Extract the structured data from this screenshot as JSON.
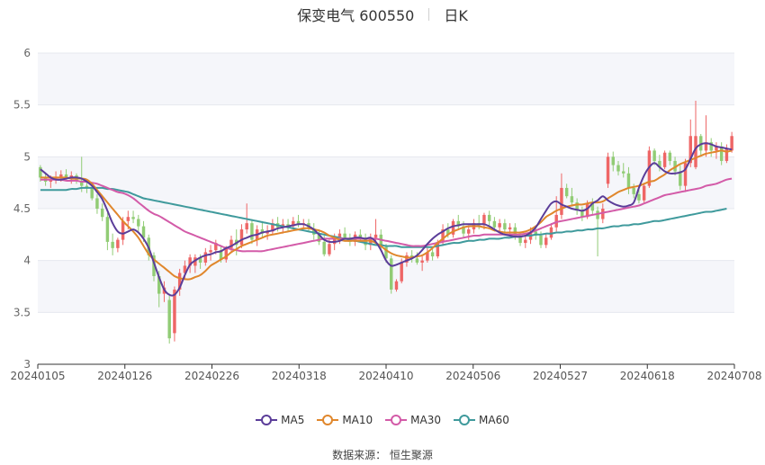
{
  "title": {
    "name": "保变电气 600550",
    "period": "日K"
  },
  "source": {
    "label": "数据来源：",
    "value": "恒生聚源"
  },
  "colors": {
    "up": "#ee6666",
    "down": "#91cc75",
    "MA5": "#5b3d99",
    "MA10": "#e0872c",
    "MA30": "#d35ba8",
    "MA60": "#3f9a9c"
  },
  "chart_data": {
    "type": "candlestick",
    "ylim": [
      3,
      6
    ],
    "y_ticks": [
      "3",
      "3.5",
      "4",
      "4.5",
      "5",
      "5.5",
      "6"
    ],
    "x_ticks": [
      "20240105",
      "20240126",
      "20240226",
      "20240318",
      "20240410",
      "20240506",
      "20240527",
      "20240618",
      "20240708"
    ],
    "legend": [
      "MA5",
      "MA10",
      "MA30",
      "MA60"
    ],
    "legend_position": "bottom",
    "ohlc": [
      [
        4.9,
        4.92,
        4.76,
        4.8
      ],
      [
        4.8,
        4.84,
        4.72,
        4.76
      ],
      [
        4.76,
        4.82,
        4.7,
        4.78
      ],
      [
        4.78,
        4.86,
        4.74,
        4.8
      ],
      [
        4.8,
        4.87,
        4.76,
        4.83
      ],
      [
        4.83,
        4.88,
        4.78,
        4.8
      ],
      [
        4.8,
        4.86,
        4.74,
        4.82
      ],
      [
        4.82,
        4.84,
        4.74,
        4.77
      ],
      [
        4.77,
        5.0,
        4.66,
        4.72
      ],
      [
        4.72,
        4.78,
        4.65,
        4.7
      ],
      [
        4.7,
        4.72,
        4.58,
        4.6
      ],
      [
        4.6,
        4.64,
        4.45,
        4.5
      ],
      [
        4.5,
        4.55,
        4.38,
        4.42
      ],
      [
        4.42,
        4.46,
        4.1,
        4.18
      ],
      [
        4.18,
        4.26,
        4.05,
        4.12
      ],
      [
        4.12,
        4.22,
        4.08,
        4.2
      ],
      [
        4.2,
        4.42,
        4.15,
        4.38
      ],
      [
        4.38,
        4.48,
        4.3,
        4.42
      ],
      [
        4.42,
        4.48,
        4.36,
        4.4
      ],
      [
        4.4,
        4.44,
        4.28,
        4.33
      ],
      [
        4.33,
        4.38,
        4.18,
        4.22
      ],
      [
        4.22,
        4.25,
        4.0,
        4.05
      ],
      [
        4.05,
        4.08,
        3.8,
        3.85
      ],
      [
        3.85,
        3.9,
        3.55,
        3.68
      ],
      [
        3.68,
        3.8,
        3.6,
        3.74
      ],
      [
        3.62,
        3.66,
        3.2,
        3.25
      ],
      [
        3.3,
        3.75,
        3.22,
        3.72
      ],
      [
        3.72,
        3.92,
        3.66,
        3.88
      ],
      [
        3.88,
        4.0,
        3.82,
        3.95
      ],
      [
        3.95,
        4.06,
        3.88,
        4.03
      ],
      [
        3.95,
        4.06,
        3.88,
        4.03
      ],
      [
        4.03,
        4.06,
        3.92,
        3.98
      ],
      [
        3.98,
        4.12,
        3.95,
        4.08
      ],
      [
        4.08,
        4.15,
        4.0,
        4.1
      ],
      [
        4.1,
        4.2,
        4.06,
        4.17
      ],
      [
        4.1,
        4.14,
        3.98,
        4.01
      ],
      [
        4.01,
        4.14,
        3.98,
        4.12
      ],
      [
        4.12,
        4.24,
        4.08,
        4.2
      ],
      [
        4.2,
        4.3,
        4.05,
        4.15
      ],
      [
        4.15,
        4.35,
        4.12,
        4.3
      ],
      [
        4.3,
        4.55,
        4.26,
        4.36
      ],
      [
        4.36,
        4.4,
        4.16,
        4.2
      ],
      [
        4.2,
        4.34,
        4.14,
        4.3
      ],
      [
        4.3,
        4.38,
        4.22,
        4.26
      ],
      [
        4.26,
        4.34,
        4.2,
        4.28
      ],
      [
        4.28,
        4.4,
        4.25,
        4.36
      ],
      [
        4.36,
        4.42,
        4.28,
        4.32
      ],
      [
        4.32,
        4.4,
        4.26,
        4.35
      ],
      [
        4.35,
        4.4,
        4.28,
        4.33
      ],
      [
        4.33,
        4.42,
        4.3,
        4.38
      ],
      [
        4.38,
        4.44,
        4.32,
        4.35
      ],
      [
        4.35,
        4.4,
        4.3,
        4.36
      ],
      [
        4.36,
        4.4,
        4.28,
        4.31
      ],
      [
        4.31,
        4.36,
        4.2,
        4.25
      ],
      [
        4.25,
        4.3,
        4.15,
        4.18
      ],
      [
        4.18,
        4.24,
        4.04,
        4.06
      ],
      [
        4.06,
        4.2,
        4.04,
        4.16
      ],
      [
        4.16,
        4.26,
        4.1,
        4.22
      ],
      [
        4.22,
        4.3,
        4.16,
        4.26
      ],
      [
        4.26,
        4.32,
        4.18,
        4.22
      ],
      [
        4.22,
        4.26,
        4.14,
        4.18
      ],
      [
        4.18,
        4.28,
        4.14,
        4.25
      ],
      [
        4.25,
        4.3,
        4.18,
        4.22
      ],
      [
        4.22,
        4.26,
        4.1,
        4.15
      ],
      [
        4.15,
        4.26,
        4.1,
        4.22
      ],
      [
        4.22,
        4.4,
        4.18,
        4.25
      ],
      [
        4.25,
        4.3,
        4.1,
        4.13
      ],
      [
        4.13,
        4.16,
        3.98,
        4.02
      ],
      [
        4.02,
        4.05,
        3.68,
        3.72
      ],
      [
        3.72,
        3.82,
        3.7,
        3.8
      ],
      [
        3.8,
        4.02,
        3.78,
        3.98
      ],
      [
        3.98,
        4.08,
        3.94,
        4.05
      ],
      [
        4.05,
        4.1,
        3.98,
        4.02
      ],
      [
        4.02,
        4.08,
        3.96,
        3.98
      ],
      [
        3.98,
        4.04,
        3.9,
        4.0
      ],
      [
        4.0,
        4.12,
        3.98,
        4.08
      ],
      [
        4.08,
        4.12,
        4.0,
        4.04
      ],
      [
        4.04,
        4.2,
        4.02,
        4.18
      ],
      [
        4.18,
        4.35,
        4.14,
        4.3
      ],
      [
        4.3,
        4.36,
        4.22,
        4.25
      ],
      [
        4.25,
        4.4,
        4.22,
        4.38
      ],
      [
        4.38,
        4.44,
        4.3,
        4.33
      ],
      [
        4.33,
        4.38,
        4.22,
        4.26
      ],
      [
        4.26,
        4.34,
        4.2,
        4.3
      ],
      [
        4.3,
        4.4,
        4.26,
        4.36
      ],
      [
        4.36,
        4.44,
        4.3,
        4.34
      ],
      [
        4.34,
        4.46,
        4.3,
        4.44
      ],
      [
        4.44,
        4.48,
        4.32,
        4.38
      ],
      [
        4.38,
        4.42,
        4.28,
        4.32
      ],
      [
        4.32,
        4.4,
        4.28,
        4.36
      ],
      [
        4.36,
        4.4,
        4.26,
        4.3
      ],
      [
        4.3,
        4.36,
        4.24,
        4.32
      ],
      [
        4.32,
        4.36,
        4.2,
        4.24
      ],
      [
        4.24,
        4.28,
        4.14,
        4.17
      ],
      [
        4.17,
        4.24,
        4.12,
        4.2
      ],
      [
        4.2,
        4.32,
        4.16,
        4.28
      ],
      [
        4.28,
        4.34,
        4.2,
        4.24
      ],
      [
        4.24,
        4.28,
        4.12,
        4.15
      ],
      [
        4.15,
        4.26,
        4.12,
        4.22
      ],
      [
        4.22,
        4.36,
        4.2,
        4.32
      ],
      [
        4.32,
        4.62,
        4.28,
        4.44
      ],
      [
        4.44,
        4.84,
        4.4,
        4.7
      ],
      [
        4.7,
        4.74,
        4.6,
        4.62
      ],
      [
        4.62,
        4.7,
        4.52,
        4.56
      ],
      [
        4.56,
        4.6,
        4.44,
        4.48
      ],
      [
        4.48,
        4.52,
        4.38,
        4.42
      ],
      [
        4.42,
        4.58,
        4.4,
        4.55
      ],
      [
        4.55,
        4.6,
        4.44,
        4.48
      ],
      [
        4.48,
        4.52,
        4.04,
        4.4
      ],
      [
        4.4,
        4.55,
        4.36,
        4.5
      ],
      [
        4.74,
        5.04,
        4.7,
        5.0
      ],
      [
        5.0,
        5.05,
        4.86,
        4.92
      ],
      [
        4.92,
        4.96,
        4.82,
        4.86
      ],
      [
        4.86,
        4.94,
        4.8,
        4.84
      ],
      [
        4.84,
        4.9,
        4.64,
        4.7
      ],
      [
        4.7,
        4.74,
        4.6,
        4.64
      ],
      [
        4.64,
        4.72,
        4.55,
        4.58
      ],
      [
        4.58,
        4.74,
        4.56,
        4.72
      ],
      [
        4.72,
        5.1,
        4.7,
        5.06
      ],
      [
        5.06,
        5.08,
        4.92,
        4.96
      ],
      [
        4.96,
        5.02,
        4.86,
        4.9
      ],
      [
        4.9,
        5.06,
        4.88,
        5.04
      ],
      [
        5.04,
        5.06,
        4.92,
        4.96
      ],
      [
        4.96,
        5.0,
        4.82,
        4.86
      ],
      [
        4.86,
        4.92,
        4.68,
        4.72
      ],
      [
        4.72,
        4.98,
        4.66,
        4.94
      ],
      [
        4.94,
        5.36,
        4.9,
        5.2
      ],
      [
        4.9,
        5.54,
        4.88,
        5.2
      ],
      [
        5.2,
        5.22,
        5.0,
        5.06
      ],
      [
        5.06,
        5.4,
        5.0,
        5.14
      ],
      [
        5.14,
        5.18,
        5.0,
        5.06
      ],
      [
        5.06,
        5.14,
        4.98,
        5.1
      ],
      [
        5.1,
        5.14,
        4.92,
        4.96
      ],
      [
        4.96,
        5.12,
        4.94,
        5.08
      ],
      [
        5.06,
        5.24,
        5.04,
        5.2
      ]
    ],
    "ma5": [
      4.88,
      4.84,
      4.8,
      4.78,
      4.78,
      4.79,
      4.8,
      4.8,
      4.79,
      4.76,
      4.72,
      4.66,
      4.59,
      4.48,
      4.36,
      4.28,
      4.26,
      4.28,
      4.3,
      4.27,
      4.21,
      4.12,
      3.98,
      3.84,
      3.72,
      3.67,
      3.67,
      3.74,
      3.86,
      3.96,
      4.0,
      4.03,
      4.05,
      4.06,
      4.08,
      4.09,
      4.12,
      4.14,
      4.17,
      4.2,
      4.22,
      4.24,
      4.25,
      4.27,
      4.28,
      4.29,
      4.31,
      4.32,
      4.33,
      4.34,
      4.35,
      4.35,
      4.33,
      4.3,
      4.25,
      4.2,
      4.18,
      4.18,
      4.19,
      4.21,
      4.21,
      4.22,
      4.22,
      4.21,
      4.22,
      4.18,
      4.1,
      4.0,
      3.95,
      3.96,
      3.98,
      4.0,
      4.02,
      4.05,
      4.1,
      4.16,
      4.21,
      4.25,
      4.28,
      4.31,
      4.33,
      4.34,
      4.35,
      4.35,
      4.35,
      4.35,
      4.35,
      4.33,
      4.3,
      4.27,
      4.25,
      4.24,
      4.23,
      4.23,
      4.24,
      4.27,
      4.32,
      4.4,
      4.48,
      4.55,
      4.57,
      4.54,
      4.52,
      4.5,
      4.49,
      4.48,
      4.5,
      4.55,
      4.58,
      4.62,
      4.58,
      4.55,
      4.53,
      4.52,
      4.53,
      4.56,
      4.7,
      4.82,
      4.9,
      4.94,
      4.9,
      4.86,
      4.84,
      4.84,
      4.85,
      4.88,
      4.98,
      5.08,
      5.12,
      5.13,
      5.12,
      5.1,
      5.09,
      5.08,
      5.07
    ],
    "ma10": [
      4.8,
      4.8,
      4.8,
      4.8,
      4.8,
      4.8,
      4.79,
      4.79,
      4.79,
      4.78,
      4.74,
      4.68,
      4.62,
      4.56,
      4.5,
      4.44,
      4.38,
      4.33,
      4.28,
      4.22,
      4.14,
      4.06,
      4.01,
      3.97,
      3.93,
      3.89,
      3.85,
      3.83,
      3.82,
      3.82,
      3.84,
      3.86,
      3.9,
      3.95,
      3.98,
      4.01,
      4.04,
      4.08,
      4.11,
      4.14,
      4.16,
      4.18,
      4.2,
      4.22,
      4.24,
      4.25,
      4.26,
      4.27,
      4.28,
      4.29,
      4.3,
      4.31,
      4.31,
      4.3,
      4.29,
      4.27,
      4.24,
      4.22,
      4.2,
      4.19,
      4.19,
      4.19,
      4.19,
      4.19,
      4.19,
      4.17,
      4.14,
      4.1,
      4.07,
      4.05,
      4.04,
      4.03,
      4.03,
      4.04,
      4.05,
      4.08,
      4.12,
      4.17,
      4.21,
      4.25,
      4.28,
      4.3,
      4.32,
      4.33,
      4.33,
      4.33,
      4.32,
      4.31,
      4.29,
      4.28,
      4.27,
      4.27,
      4.27,
      4.27,
      4.28,
      4.3,
      4.33,
      4.37,
      4.42,
      4.45,
      4.48,
      4.5,
      4.52,
      4.53,
      4.54,
      4.54,
      4.55,
      4.56,
      4.56,
      4.57,
      4.6,
      4.63,
      4.66,
      4.68,
      4.7,
      4.71,
      4.72,
      4.74,
      4.76,
      4.77,
      4.8,
      4.83,
      4.87,
      4.9,
      4.93,
      4.95,
      4.97,
      4.99,
      5.01,
      5.03,
      5.04,
      5.05,
      5.06,
      5.05,
      5.06
    ],
    "ma30": [
      4.78,
      4.78,
      4.78,
      4.78,
      4.78,
      4.77,
      4.77,
      4.77,
      4.76,
      4.76,
      4.75,
      4.74,
      4.72,
      4.7,
      4.68,
      4.66,
      4.65,
      4.63,
      4.6,
      4.56,
      4.52,
      4.48,
      4.45,
      4.43,
      4.4,
      4.37,
      4.34,
      4.31,
      4.28,
      4.26,
      4.24,
      4.22,
      4.2,
      4.18,
      4.16,
      4.14,
      4.12,
      4.11,
      4.1,
      4.09,
      4.09,
      4.09,
      4.09,
      4.09,
      4.1,
      4.11,
      4.12,
      4.13,
      4.14,
      4.15,
      4.16,
      4.17,
      4.18,
      4.19,
      4.2,
      4.21,
      4.21,
      4.21,
      4.21,
      4.21,
      4.21,
      4.21,
      4.21,
      4.21,
      4.21,
      4.21,
      4.2,
      4.19,
      4.18,
      4.17,
      4.16,
      4.15,
      4.14,
      4.14,
      4.14,
      4.15,
      4.16,
      4.17,
      4.18,
      4.19,
      4.2,
      4.21,
      4.22,
      4.23,
      4.24,
      4.24,
      4.25,
      4.25,
      4.25,
      4.25,
      4.25,
      4.25,
      4.25,
      4.25,
      4.26,
      4.27,
      4.29,
      4.31,
      4.33,
      4.35,
      4.37,
      4.38,
      4.39,
      4.4,
      4.41,
      4.42,
      4.43,
      4.44,
      4.45,
      4.46,
      4.47,
      4.48,
      4.49,
      4.5,
      4.51,
      4.52,
      4.53,
      4.55,
      4.57,
      4.59,
      4.61,
      4.63,
      4.64,
      4.65,
      4.66,
      4.67,
      4.68,
      4.69,
      4.7,
      4.72,
      4.73,
      4.74,
      4.76,
      4.78,
      4.79
    ],
    "ma60": [
      4.68,
      4.68,
      4.68,
      4.68,
      4.68,
      4.68,
      4.69,
      4.69,
      4.7,
      4.7,
      4.7,
      4.7,
      4.7,
      4.69,
      4.69,
      4.68,
      4.67,
      4.66,
      4.64,
      4.62,
      4.6,
      4.59,
      4.58,
      4.57,
      4.56,
      4.55,
      4.54,
      4.53,
      4.52,
      4.51,
      4.5,
      4.49,
      4.48,
      4.47,
      4.46,
      4.45,
      4.44,
      4.43,
      4.42,
      4.41,
      4.4,
      4.39,
      4.38,
      4.37,
      4.36,
      4.35,
      4.34,
      4.33,
      4.32,
      4.31,
      4.3,
      4.29,
      4.28,
      4.27,
      4.26,
      4.25,
      4.24,
      4.23,
      4.22,
      4.21,
      4.2,
      4.19,
      4.18,
      4.17,
      4.16,
      4.15,
      4.15,
      4.14,
      4.14,
      4.14,
      4.13,
      4.13,
      4.13,
      4.13,
      4.13,
      4.13,
      4.13,
      4.14,
      4.15,
      4.16,
      4.17,
      4.17,
      4.18,
      4.19,
      4.19,
      4.2,
      4.2,
      4.21,
      4.21,
      4.21,
      4.22,
      4.22,
      4.23,
      4.23,
      4.24,
      4.24,
      4.25,
      4.25,
      4.26,
      4.26,
      4.27,
      4.27,
      4.28,
      4.28,
      4.29,
      4.29,
      4.3,
      4.3,
      4.31,
      4.31,
      4.32,
      4.33,
      4.33,
      4.34,
      4.34,
      4.35,
      4.35,
      4.36,
      4.37,
      4.38,
      4.38,
      4.39,
      4.4,
      4.41,
      4.42,
      4.43,
      4.44,
      4.45,
      4.46,
      4.47,
      4.47,
      4.48,
      4.49,
      4.5
    ]
  }
}
